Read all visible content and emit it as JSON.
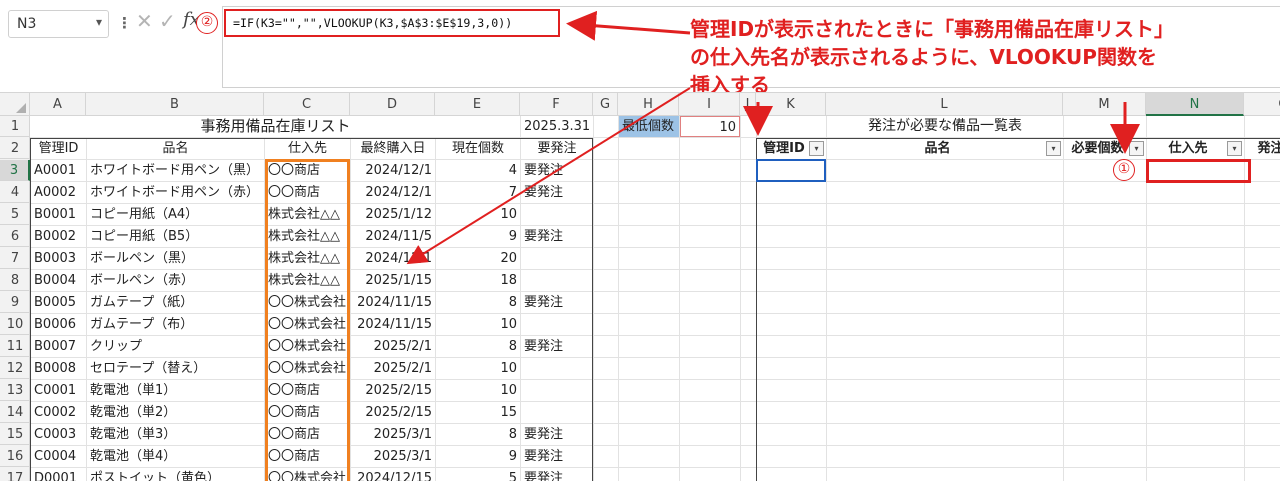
{
  "formula_bar": {
    "name_box": "N3",
    "fx_label": "fx",
    "formula": "=IF(K3=\"\",\"\",VLOOKUP(K3,$A$3:$E$19,3,0))",
    "step_marker": "②"
  },
  "callout": {
    "line1": "管理IDが表示されたときに「事務用備品在庫リスト」",
    "line2": "の仕入先名が表示されるように、VLOOKUP関数を",
    "line3": "挿入する"
  },
  "step_marker_1": "①",
  "columns": [
    "A",
    "B",
    "C",
    "D",
    "E",
    "F",
    "G",
    "H",
    "I",
    "J",
    "K",
    "L",
    "M",
    "N",
    "O"
  ],
  "rows": [
    "1",
    "2",
    "3",
    "4",
    "5",
    "6",
    "7",
    "8",
    "9",
    "10",
    "11",
    "12",
    "13",
    "14",
    "15",
    "16",
    "17"
  ],
  "sheet": {
    "inventory_title": "事務用備品在庫リスト",
    "report_date": "2025.3.31",
    "min_stock_label": "最低個数",
    "min_stock_value": "10",
    "order_title": "発注が必要な備品一覧表",
    "inventory_headers": [
      "管理ID",
      "品名",
      "仕入先",
      "最終購入日",
      "現在個数",
      "要発注"
    ],
    "inventory_rows": [
      [
        "A0001",
        "ホワイトボード用ペン（黒）",
        "〇〇商店",
        "2024/12/1",
        "4",
        "要発注"
      ],
      [
        "A0002",
        "ホワイトボード用ペン（赤）",
        "〇〇商店",
        "2024/12/1",
        "7",
        "要発注"
      ],
      [
        "B0001",
        "コピー用紙（A4）",
        "株式会社△△",
        "2025/1/12",
        "10",
        ""
      ],
      [
        "B0002",
        "コピー用紙（B5）",
        "株式会社△△",
        "2024/11/5",
        "9",
        "要発注"
      ],
      [
        "B0003",
        "ボールペン（黒）",
        "株式会社△△",
        "2024/12/1",
        "20",
        ""
      ],
      [
        "B0004",
        "ボールペン（赤）",
        "株式会社△△",
        "2025/1/15",
        "18",
        ""
      ],
      [
        "B0005",
        "ガムテープ（紙）",
        "〇〇株式会社",
        "2024/11/15",
        "8",
        "要発注"
      ],
      [
        "B0006",
        "ガムテープ（布）",
        "〇〇株式会社",
        "2024/11/15",
        "10",
        ""
      ],
      [
        "B0007",
        "クリップ",
        "〇〇株式会社",
        "2025/2/1",
        "8",
        "要発注"
      ],
      [
        "B0008",
        "セロテープ（替え）",
        "〇〇株式会社",
        "2025/2/1",
        "10",
        ""
      ],
      [
        "C0001",
        "乾電池（単1）",
        "〇〇商店",
        "2025/2/15",
        "10",
        ""
      ],
      [
        "C0002",
        "乾電池（単2）",
        "〇〇商店",
        "2025/2/15",
        "15",
        ""
      ],
      [
        "C0003",
        "乾電池（単3）",
        "〇〇商店",
        "2025/3/1",
        "8",
        "要発注"
      ],
      [
        "C0004",
        "乾電池（単4）",
        "〇〇商店",
        "2025/3/1",
        "9",
        "要発注"
      ],
      [
        "D0001",
        "ポストイット（黄色）",
        "〇〇株式会社",
        "2024/12/15",
        "5",
        "要発注"
      ]
    ],
    "order_headers": [
      "管理ID",
      "品名",
      "必要個数",
      "仕入先",
      "発注日"
    ]
  }
}
